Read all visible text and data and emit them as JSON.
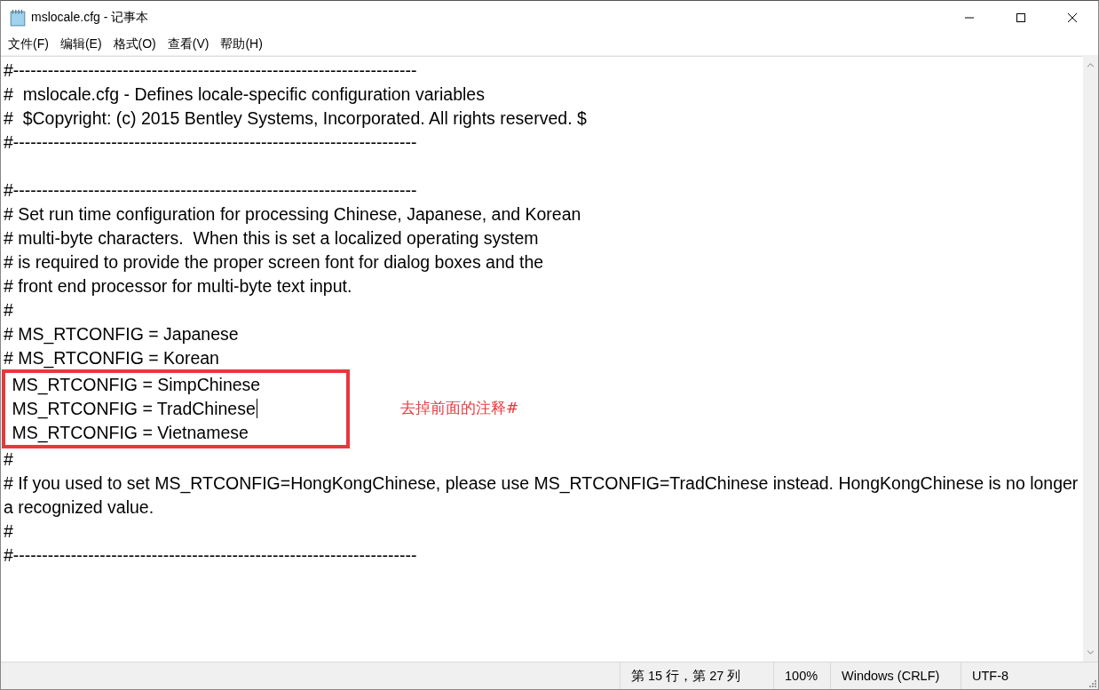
{
  "window": {
    "title": "mslocale.cfg - 记事本"
  },
  "menu": [
    {
      "label": "文件(F)"
    },
    {
      "label": "编辑(E)"
    },
    {
      "label": "格式(O)"
    },
    {
      "label": "查看(V)"
    },
    {
      "label": "帮助(H)"
    }
  ],
  "lines": [
    {
      "text": "#----------------------------------------------------------------------",
      "boxed": false,
      "caret": false
    },
    {
      "text": "#  mslocale.cfg - Defines locale-specific configuration variables",
      "boxed": false,
      "caret": false
    },
    {
      "text": "#  $Copyright: (c) 2015 Bentley Systems, Incorporated. All rights reserved. $",
      "boxed": false,
      "caret": false
    },
    {
      "text": "#----------------------------------------------------------------------",
      "boxed": false,
      "caret": false
    },
    {
      "boxed": false,
      "caret": false
    },
    {
      "text": "#----------------------------------------------------------------------",
      "boxed": false,
      "caret": false
    },
    {
      "text": "# Set run time configuration for processing Chinese, Japanese, and Korean",
      "boxed": false,
      "caret": false
    },
    {
      "text": "# multi-byte characters.  When this is set a localized operating system",
      "boxed": false,
      "caret": false
    },
    {
      "text": "# is required to provide the proper screen font for dialog boxes and the",
      "boxed": false,
      "caret": false
    },
    {
      "text": "# front end processor for multi-byte text input.",
      "boxed": false,
      "caret": false
    },
    {
      "text": "#",
      "boxed": false,
      "caret": false
    },
    {
      "text": "# MS_RTCONFIG = Japanese",
      "boxed": false,
      "caret": false
    },
    {
      "text": "# MS_RTCONFIG = Korean",
      "boxed": false,
      "caret": false
    },
    {
      "text": " MS_RTCONFIG = SimpChinese",
      "boxed": true,
      "caret": false
    },
    {
      "text": " MS_RTCONFIG = TradChinese",
      "boxed": true,
      "caret": true
    },
    {
      "text": " MS_RTCONFIG = Vietnamese",
      "boxed": true,
      "caret": false
    },
    {
      "text": "#",
      "boxed": false,
      "caret": false
    },
    {
      "text": "# If you used to set MS_RTCONFIG=HongKongChinese, please use MS_RTCONFIG=TradChinese instead. HongKongChinese is no longer a recognized value.",
      "boxed": false,
      "caret": false
    },
    {
      "text": "#",
      "boxed": false,
      "caret": false
    },
    {
      "text": "#----------------------------------------------------------------------",
      "boxed": false,
      "caret": false
    }
  ],
  "annotation": {
    "note": "去掉前面的注释#"
  },
  "status_bar": {
    "position": "第 15 行，第 27 列",
    "zoom": "100%",
    "line_ending": "Windows (CRLF)",
    "encoding": "UTF-8"
  }
}
